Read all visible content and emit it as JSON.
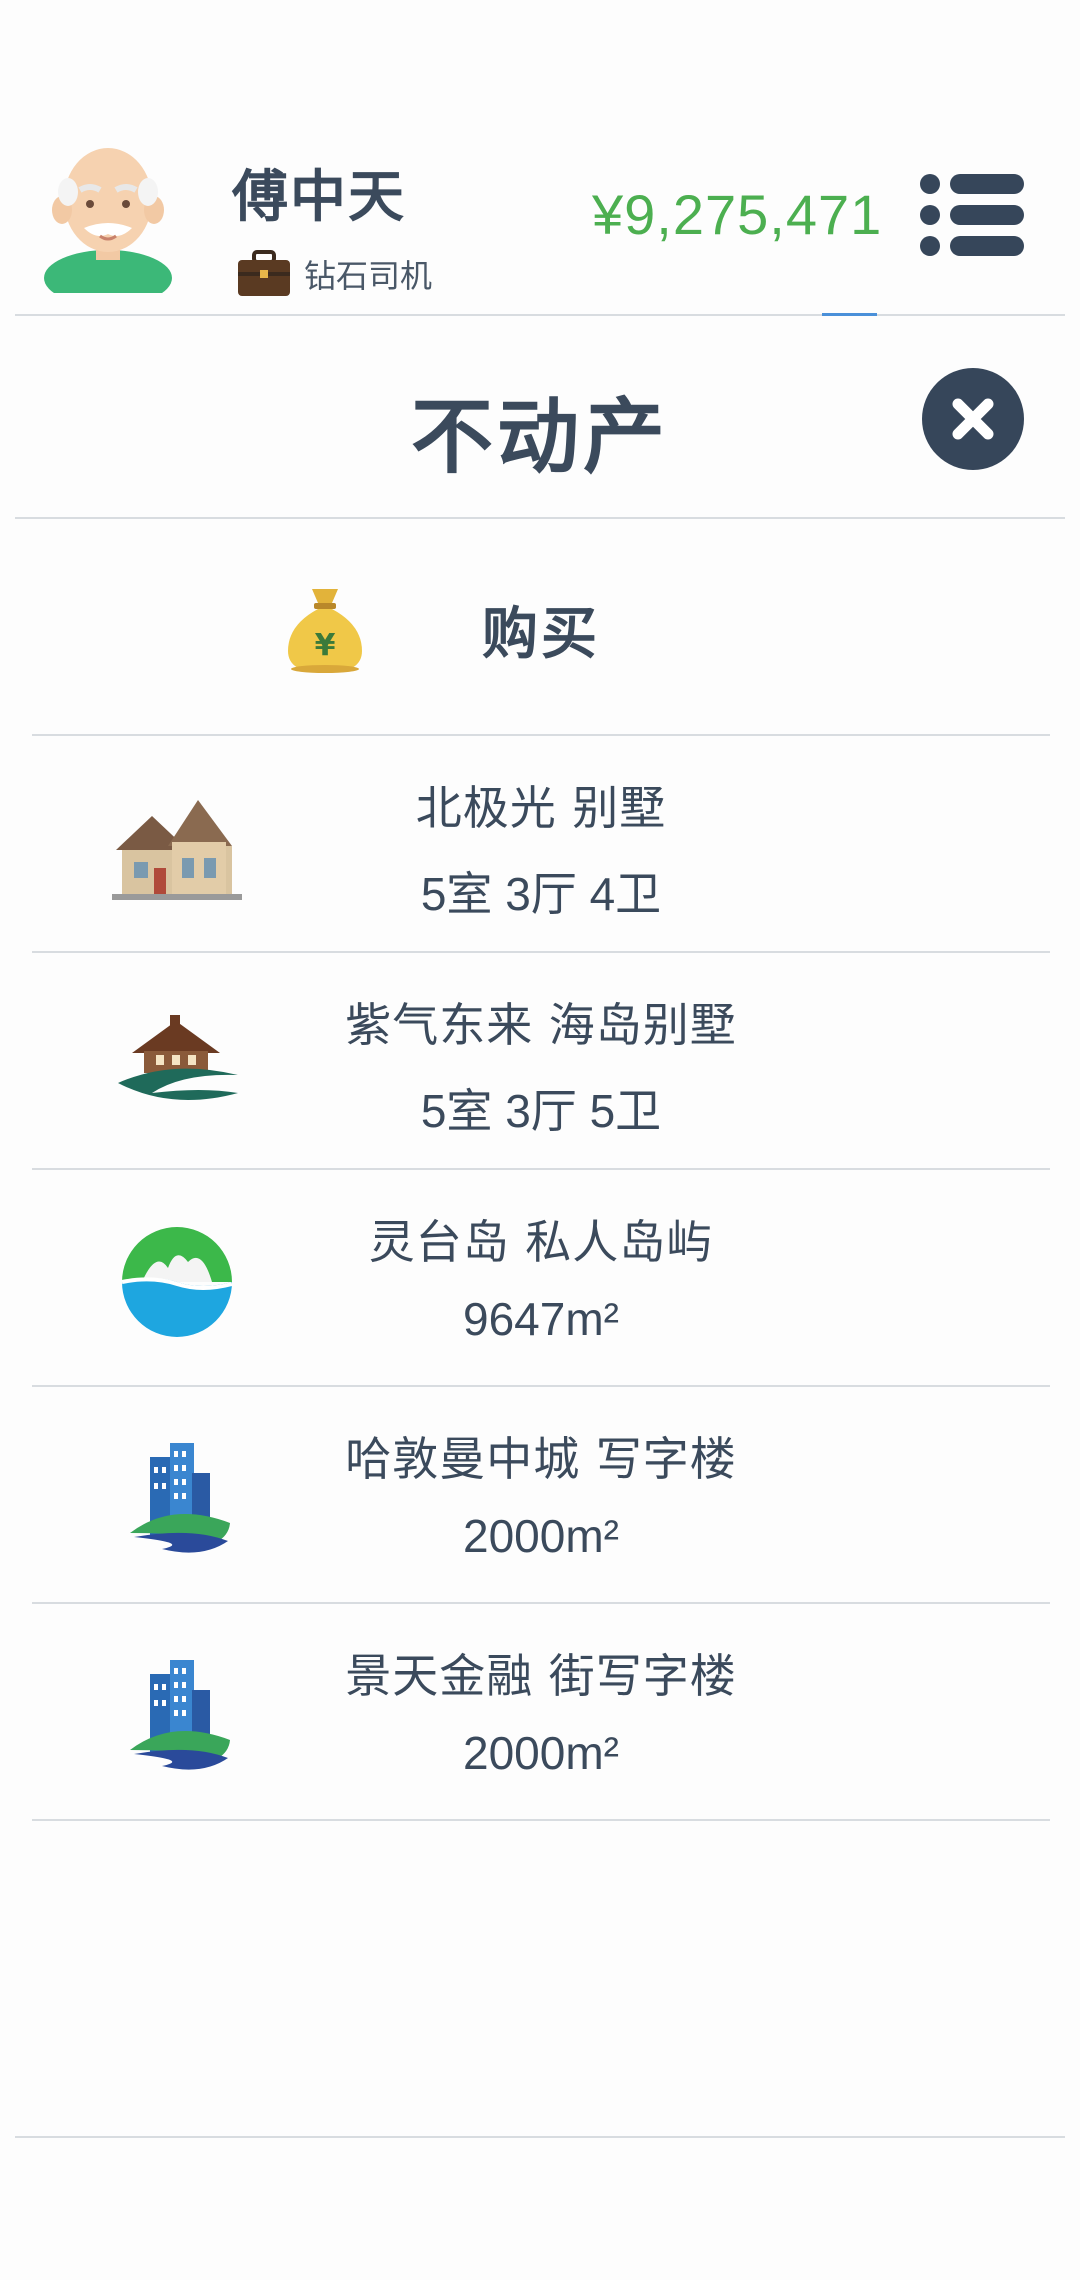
{
  "header": {
    "user_name": "傅中天",
    "job_title": "钻石司机",
    "balance": "¥9,275,471",
    "avatar_icon": "old-man-avatar",
    "job_icon": "briefcase-icon",
    "menu_icon": "list-menu-icon",
    "balance_color": "#4caf50"
  },
  "section": {
    "title": "不动产",
    "close_icon": "close-icon"
  },
  "buy": {
    "label": "购买",
    "icon": "money-bag-icon"
  },
  "properties": [
    {
      "name": "北极光 别墅",
      "detail": "5室 3厅 4卫",
      "icon": "villa-icon"
    },
    {
      "name": "紫气东来 海岛别墅",
      "detail": "5室 3厅 5卫",
      "icon": "island-villa-icon"
    },
    {
      "name": "灵台岛 私人岛屿",
      "detail": "9647m²",
      "icon": "island-icon"
    },
    {
      "name": "哈敦曼中城 写字楼",
      "detail": "2000m²",
      "icon": "office-building-icon"
    },
    {
      "name": "景天金融 街写字楼",
      "detail": "2000m²",
      "icon": "office-building-icon"
    }
  ]
}
